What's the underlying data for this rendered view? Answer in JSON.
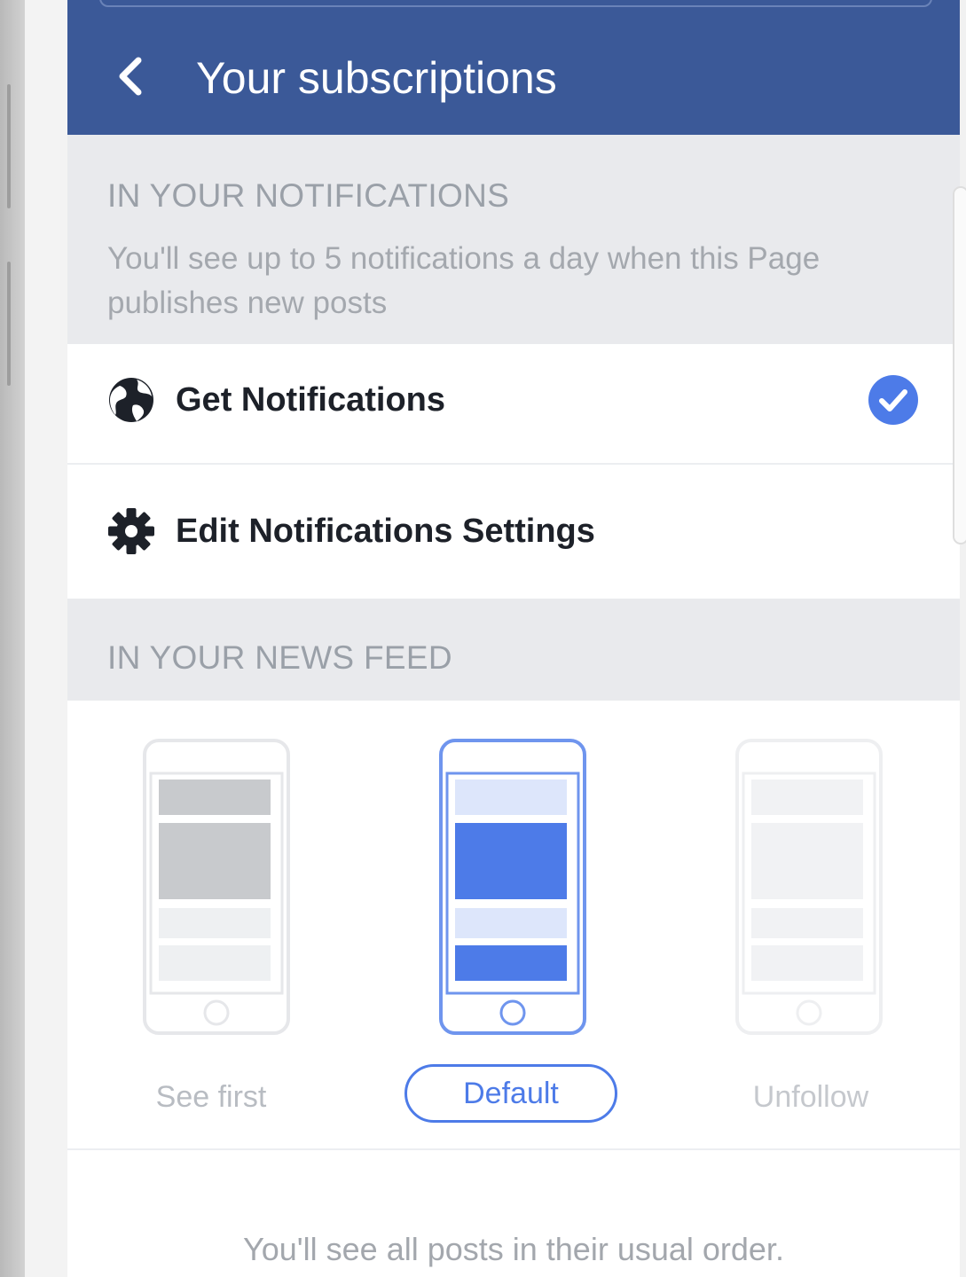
{
  "header": {
    "title": "Your subscriptions",
    "color": "#3b5998"
  },
  "notifications_section": {
    "label": "IN YOUR NOTIFICATIONS",
    "description": "You'll see up to 5 notifications a day when this Page publishes new posts",
    "get_notifications": {
      "label": "Get Notifications",
      "icon": "globe-icon",
      "checked": true
    },
    "edit_settings": {
      "label": "Edit Notifications Settings",
      "icon": "gear-icon"
    }
  },
  "news_feed_section": {
    "label": "IN YOUR NEWS FEED",
    "options": [
      {
        "label": "See first",
        "selected": false
      },
      {
        "label": "Default",
        "selected": true
      },
      {
        "label": "Unfollow",
        "selected": false
      }
    ],
    "selected_description": "You'll see all posts in their usual order."
  },
  "colors": {
    "accent": "#4d7be8",
    "background_section": "#e9eaed"
  }
}
